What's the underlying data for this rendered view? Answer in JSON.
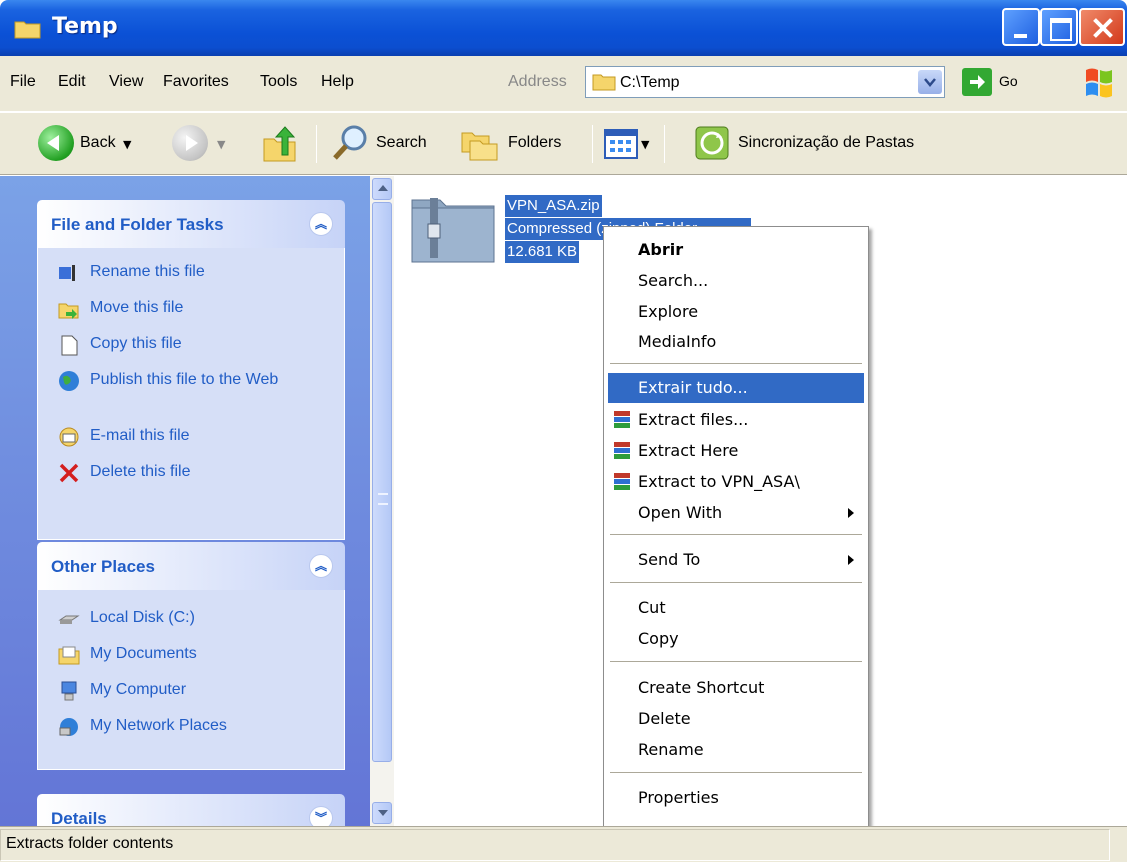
{
  "window": {
    "title": "Temp"
  },
  "menubar": {
    "items": [
      "File",
      "Edit",
      "View",
      "Favorites",
      "Tools",
      "Help"
    ],
    "address_label": "Address",
    "address_value": "C:\\Temp",
    "go_label": "Go"
  },
  "toolbar": {
    "back_label": "Back",
    "search_label": "Search",
    "folders_label": "Folders",
    "sync_label": "Sincronização de Pastas"
  },
  "tasks_panel": {
    "title": "File and Folder Tasks",
    "items": [
      {
        "label": "Rename this file",
        "icon": "rename-icon"
      },
      {
        "label": "Move this file",
        "icon": "move-icon"
      },
      {
        "label": "Copy this file",
        "icon": "copy-icon"
      },
      {
        "label": "Publish this file to the Web",
        "icon": "globe-icon"
      },
      {
        "label": "E-mail this file",
        "icon": "email-icon"
      },
      {
        "label": "Delete this file",
        "icon": "delete-icon"
      }
    ]
  },
  "places_panel": {
    "title": "Other Places",
    "items": [
      {
        "label": "Local Disk (C:)",
        "icon": "drive-icon"
      },
      {
        "label": "My Documents",
        "icon": "documents-icon"
      },
      {
        "label": "My Computer",
        "icon": "computer-icon"
      },
      {
        "label": "My Network Places",
        "icon": "network-icon"
      }
    ]
  },
  "details_panel": {
    "title": "Details"
  },
  "file": {
    "name": "VPN_ASA.zip",
    "type": "Compressed (zipped) Folder",
    "size": "12.681 KB"
  },
  "context_menu": {
    "open": "Abrir",
    "search": "Search...",
    "explore": "Explore",
    "mediainfo": "MediaInfo",
    "extract_all": "Extrair tudo...",
    "extract_files": "Extract files...",
    "extract_here": "Extract Here",
    "extract_to": "Extract to VPN_ASA\\",
    "open_with": "Open With",
    "send_to": "Send To",
    "cut": "Cut",
    "copy": "Copy",
    "create_shortcut": "Create Shortcut",
    "delete": "Delete",
    "rename": "Rename",
    "properties": "Properties"
  },
  "statusbar": {
    "text": "Extracts folder contents"
  },
  "colors": {
    "titlebar": "#0b51d6",
    "selection": "#316ac5",
    "task_text": "#215dc6"
  }
}
